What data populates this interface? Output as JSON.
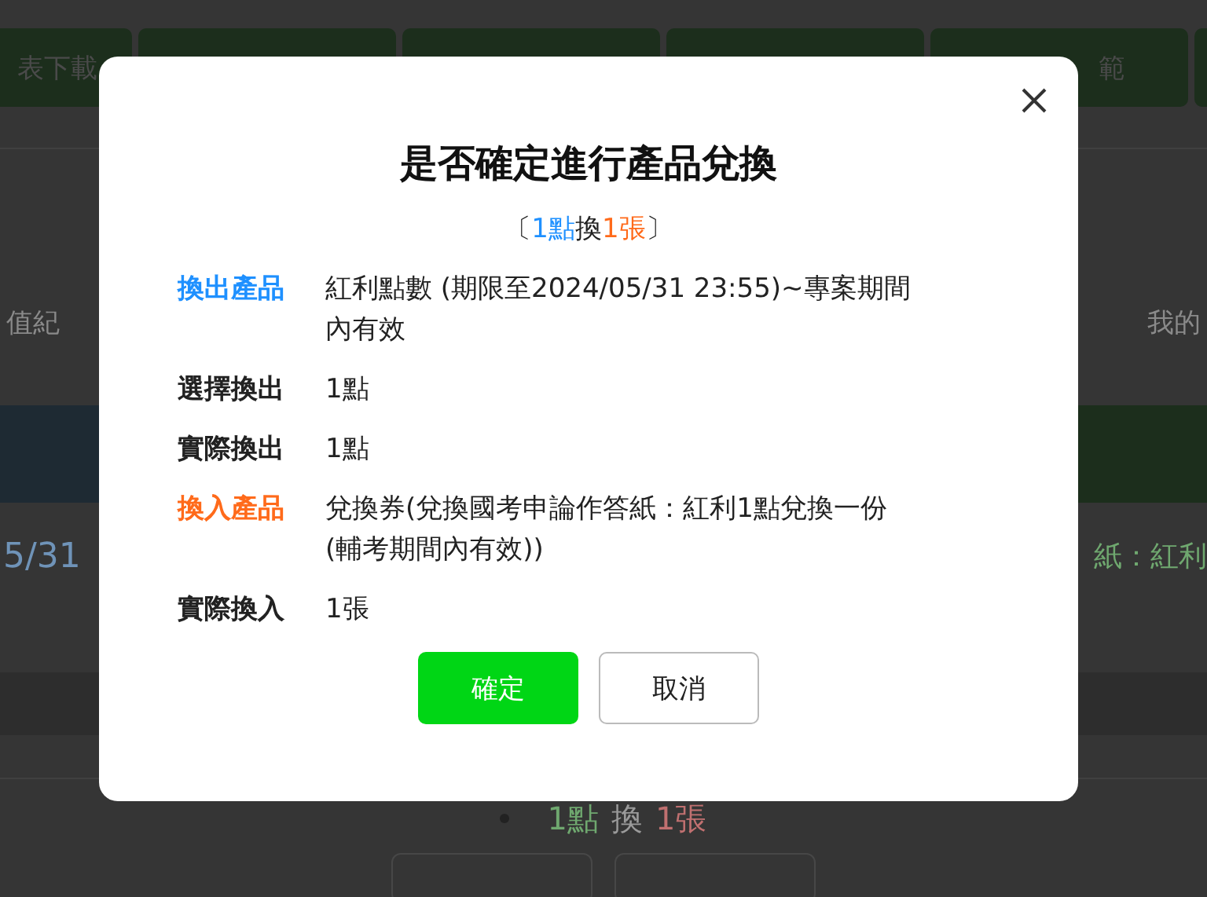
{
  "background": {
    "tabs": [
      {
        "label": "表下載"
      },
      {
        "label": "範"
      }
    ],
    "nav_left": "值紀",
    "nav_right": "我的",
    "date_fragment": "5/31",
    "product_fragment": "紙：紅利",
    "exchange_summary": {
      "points": "1點",
      "verb": "換",
      "result": "1張"
    }
  },
  "dialog": {
    "title": "是否確定進行產品兌換",
    "subtitle": {
      "open": "〔",
      "points": "1點",
      "verb": "換",
      "result": "1張",
      "close": "〕"
    },
    "rows": [
      {
        "kind": "out",
        "label": "換出產品",
        "value": "紅利點數 (期限至2024/05/31 23:55)~專案期間內有效"
      },
      {
        "kind": "plain",
        "label": "選擇換出",
        "value": "1點"
      },
      {
        "kind": "plain",
        "label": "實際換出",
        "value": "1點"
      },
      {
        "kind": "in",
        "label": "換入產品",
        "value": "兌換券(兌換國考申論作答紙：紅利1點兌換一份(輔考期間內有效))"
      },
      {
        "kind": "plain",
        "label": "實際換入",
        "value": "1張"
      }
    ],
    "buttons": [
      {
        "kind": "primary",
        "label": "確定"
      },
      {
        "kind": "secondary",
        "label": "取消"
      }
    ]
  }
}
